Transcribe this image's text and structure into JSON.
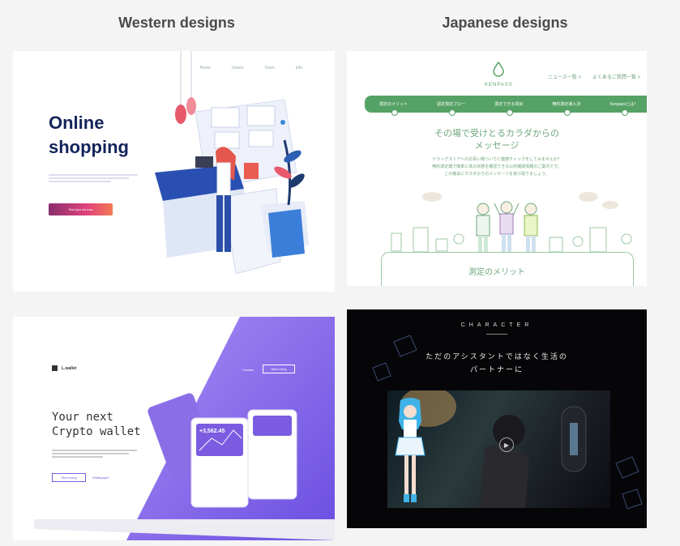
{
  "headings": {
    "western": "Western designs",
    "japanese": "Japanese designs"
  },
  "panel_shopping": {
    "nav": [
      "Home",
      "Issues",
      "Team",
      "Info"
    ],
    "title_line1": "Online",
    "title_line2": "shopping",
    "button_label": "Start journal now"
  },
  "panel_kenpass": {
    "brand": "KENPASS",
    "top_links": [
      "ニュース一覧 >",
      "よくあるご質問一覧 >"
    ],
    "menu": [
      "測定のメリット",
      "認定測定フロー",
      "測定できる項目",
      "無料測定導入法",
      "Kenpassとは？"
    ],
    "headline_line1": "その場で受けとるカラダからの",
    "headline_line2": "メッセージ",
    "body_lines": [
      "ドラッグストアへのお買い物ついでに健康チェックをしてみませんか？",
      "無料測定器で簡単に体の状態を確認できる公的機関情報のご案内です。",
      "この機会にカラダからのメッセージを受け取りましょう。"
    ],
    "footer_label": "測定のメリット"
  },
  "panel_crypto": {
    "logo": "L.wallet",
    "small_label": "",
    "title_line1": "Your next",
    "title_line2": "Crypto wallet",
    "button_label": "Start using",
    "link_label": "Whitepaper",
    "top_link": "Contact",
    "top_button": "Start using",
    "balance": "+3,562.45"
  },
  "panel_character": {
    "label": "CHARACTER",
    "caption_line1": "ただのアシスタントではなく生活の",
    "caption_line2": "パートナーに"
  }
}
